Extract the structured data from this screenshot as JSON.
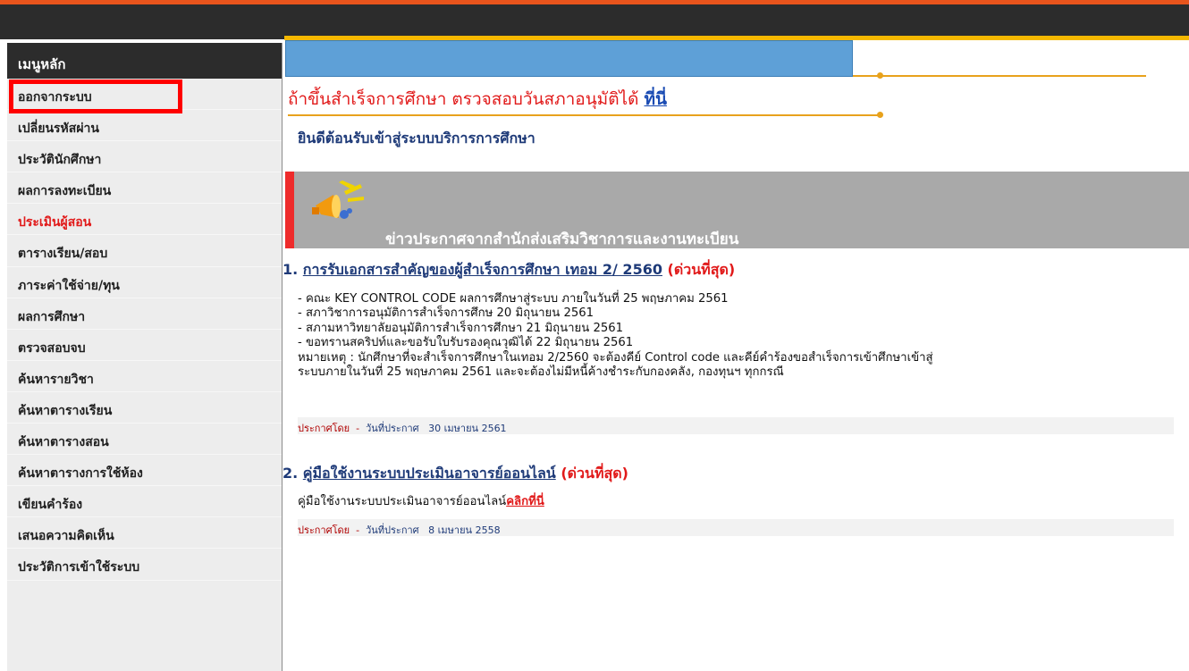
{
  "sidebar": {
    "header": "เมนูหลัก",
    "items": [
      {
        "label": "ออกจากระบบ",
        "highlight": false
      },
      {
        "label": "เปลี่ยนรหัสผ่าน",
        "highlight": false
      },
      {
        "label": "ประวัตินักศึกษา",
        "highlight": false
      },
      {
        "label": "ผลการลงทะเบียน",
        "highlight": false
      },
      {
        "label": "ประเมินผู้สอน",
        "highlight": true
      },
      {
        "label": "ตารางเรียน/สอบ",
        "highlight": false
      },
      {
        "label": "ภาระค่าใช้จ่าย/ทุน",
        "highlight": false
      },
      {
        "label": "ผลการศึกษา",
        "highlight": false
      },
      {
        "label": "ตรวจสอบจบ",
        "highlight": false
      },
      {
        "label": "ค้นหารายวิชา",
        "highlight": false
      },
      {
        "label": "ค้นหาตารางเรียน",
        "highlight": false
      },
      {
        "label": "ค้นหาตารางสอน",
        "highlight": false
      },
      {
        "label": "ค้นหาตารางการใช้ห้อง",
        "highlight": false
      },
      {
        "label": "เขียนคำร้อง",
        "highlight": false
      },
      {
        "label": "เสนอความคิดเห็น",
        "highlight": false
      },
      {
        "label": "ประวัติการเข้าใช้ระบบ",
        "highlight": false
      }
    ]
  },
  "main": {
    "alert_text": "ถ้าขึ้นสำเร็จการศึกษา ตรวจสอบวันสภาอนุมัติได้ ",
    "alert_link": "ที่นี่",
    "welcome": "ยินดีต้อนรับเข้าสู่ระบบบริการการศึกษา",
    "news_title": "ข่าวประกาศจากสำนักส่งเสริมวิชาการและงานทะเบียน",
    "announcements": [
      {
        "num": "1.",
        "title": "การรับเอกสารสำคัญของผู้สำเร็จการศึกษา เทอม 2/ 2560",
        "urgent": "(ด่วนที่สุด)",
        "lines": [
          "- คณะ KEY CONTROL CODE ผลการศึกษาสู่ระบบ ภายในวันที่ 25 พฤษภาคม 2561",
          "- สภาวิชาการอนุมัติการสำเร็จการศึกษ 20 มิถุนายน 2561",
          "- สภามหาวิทยาลัยอนุมัติการสำเร็จการศึกษา 21 มิถุนายน 2561",
          "- ขอทรานสคริปท์และขอรับใบรับรองคุณวุฒิได้ 22 มิถุนายน 2561",
          "หมายเหตุ : นักศึกษาที่จะสำเร็จการศึกษาในเทอม 2/2560 จะต้องคีย์ Control code และคีย์คำร้องขอสำเร็จการเข้าศึกษาเข้าสู่",
          "ระบบภายในวันที่ 25 พฤษภาคม 2561 และจะต้องไม่มีหนี้ค้างชำระกับกองคลัง, กองทุนฯ ทุกกรณี"
        ],
        "posted_by": "ประกาศโดย",
        "date_label": "วันที่ประกาศ",
        "date": "30 เมษายน 2561"
      },
      {
        "num": "2.",
        "title": "คู่มือใช้งานระบบประเมินอาจารย์ออนไลน์",
        "urgent": "(ด่วนที่สุด)",
        "body": "คู่มือใช้งานระบบประเมินอาจารย์ออนไลน์",
        "body_link": "คลิกที่นี่",
        "posted_by": "ประกาศโดย",
        "date_label": "วันที่ประกาศ",
        "date": "8 เมษายน 2558"
      }
    ]
  },
  "colors": {
    "topbar": "#2c2c2c",
    "accent_orange": "#e8541c",
    "accent_gold": "#f5b800",
    "link_blue": "#1e3a78",
    "urgent_red": "#e11a1a",
    "banner_grey": "#a9a9a9",
    "blue_bar": "#5ea0d7"
  }
}
